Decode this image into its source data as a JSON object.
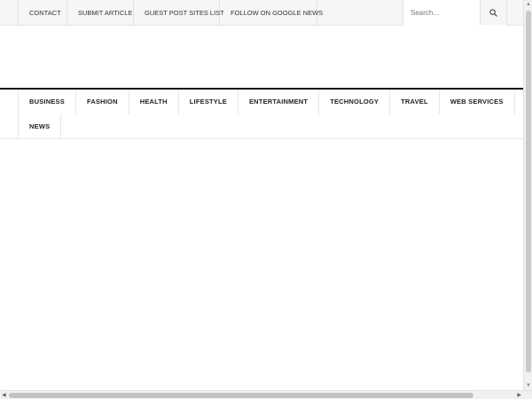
{
  "topbar": {
    "links": [
      "CONTACT",
      "SUBMIT ARTICLE",
      "GUEST POST SITES LIST",
      "FOLLOW ON GOOGLE NEWS"
    ],
    "search": {
      "placeholder": "Search...",
      "icon": "search-icon"
    }
  },
  "mainnav": {
    "items": [
      "BUSINESS",
      "FASHION",
      "HEALTH",
      "LIFESTYLE",
      "ENTERTAINMENT",
      "TECHNOLOGY",
      "TRAVEL",
      "WEB SERVICES",
      "NEWS"
    ]
  },
  "colors": {
    "topbar_bg": "#f6f6f6",
    "nav_border": "#111111",
    "text": "#222222"
  }
}
